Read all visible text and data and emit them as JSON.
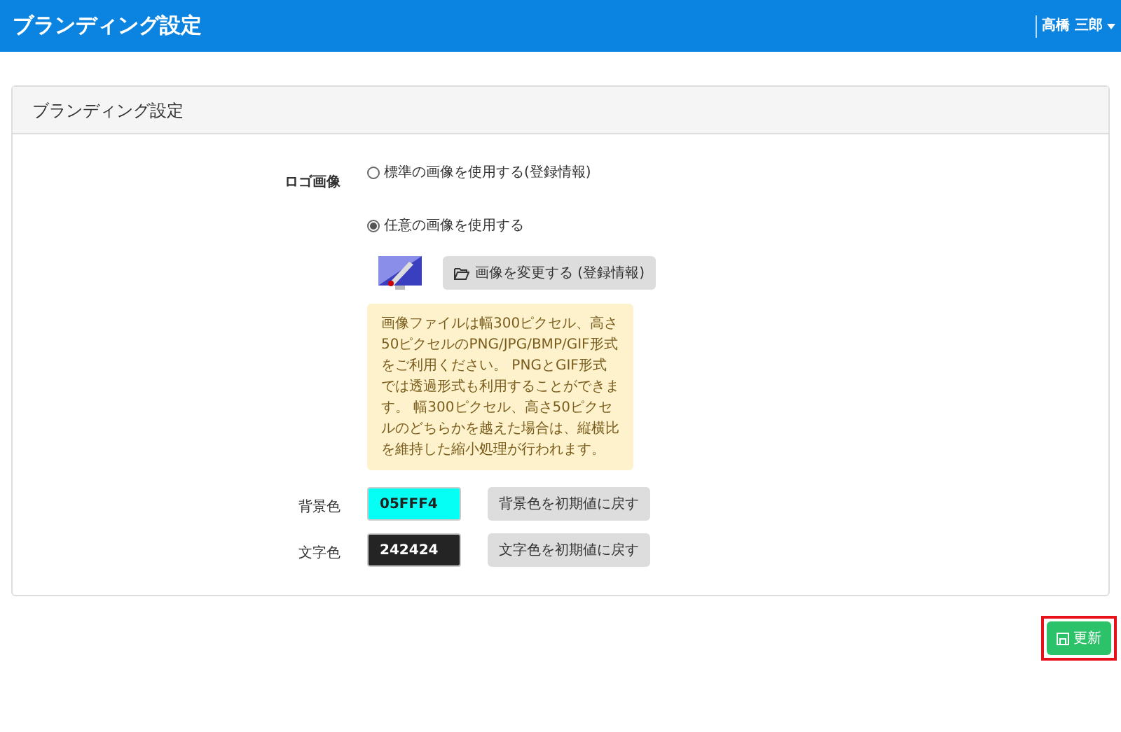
{
  "header": {
    "title": "ブランディング設定",
    "user": "高橋 三郎"
  },
  "card": {
    "title": "ブランディング設定"
  },
  "logo": {
    "label": "ロゴ画像",
    "options": [
      {
        "label": "標準の画像を使用する(登録情報)",
        "selected": false
      },
      {
        "label": "任意の画像を使用する",
        "selected": true
      }
    ],
    "change_button": "画像を変更する (登録情報)",
    "note": "画像ファイルは幅300ピクセル、高さ50ピクセルのPNG/JPG/BMP/GIF形式をご利用ください。 PNGとGIF形式では透過形式も利用することができます。 幅300ピクセル、高さ50ピクセルのどちらかを越えた場合は、縦横比を維持した縮小処理が行われます。"
  },
  "colors": [
    {
      "label": "背景色",
      "value": "05FFF4",
      "color": "#05fff4",
      "reset_button": "背景色を初期値に戻す"
    },
    {
      "label": "文字色",
      "value": "242424",
      "color": "#242424",
      "reset_button": "文字色を初期値に戻す"
    }
  ],
  "update_button": "更新"
}
